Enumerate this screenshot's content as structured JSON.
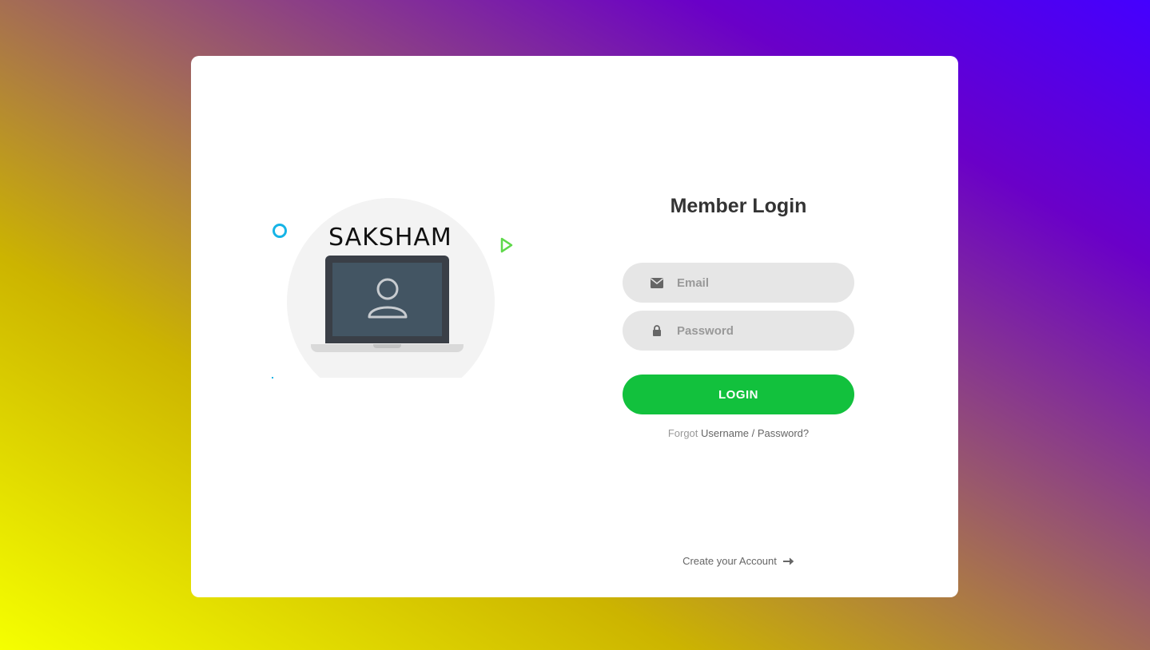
{
  "brand": {
    "name": "SAKSHAM"
  },
  "login": {
    "title": "Member Login",
    "email_placeholder": "Email",
    "password_placeholder": "Password",
    "login_label": "LOGIN",
    "forgot_prefix": "Forgot",
    "forgot_link": "Username / Password?",
    "create_account": "Create your Account"
  },
  "colors": {
    "accent_green": "#12c13d",
    "field_bg": "#e6e6e6",
    "deco_ring": "#16b4e6",
    "deco_triangle": "#5ed84a"
  },
  "icons": {
    "email": "envelope-icon",
    "password": "lock-icon",
    "create": "arrow-right-icon"
  }
}
